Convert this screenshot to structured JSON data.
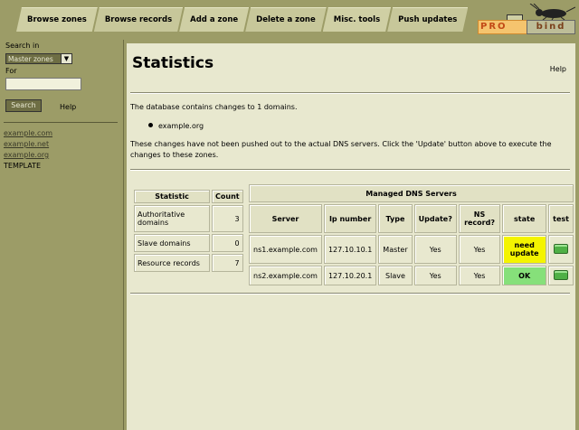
{
  "nav": {
    "tabs": [
      "Browse zones",
      "Browse records",
      "Add a zone",
      "Delete a zone",
      "Misc. tools",
      "Push updates"
    ]
  },
  "logo": {
    "pro": "PRO",
    "bind": "bind"
  },
  "sidebar": {
    "search_in_label": "Search in",
    "zone_type_selected": "Master zones",
    "for_label": "For",
    "search_value": "",
    "search_button": "Search",
    "help_link": "Help",
    "domains": [
      "example.com",
      "example.net",
      "example.org"
    ],
    "template": "TEMPLATE"
  },
  "main": {
    "title": "Statistics",
    "help_link": "Help",
    "changes_text": "The database contains changes to 1 domains.",
    "changed_domain": "example.org",
    "not_pushed_text": "These changes have not been pushed out to the actual DNS servers. Click the 'Update' button above to execute the changes to these zones."
  },
  "stats_table": {
    "headers": [
      "Statistic",
      "Count"
    ],
    "rows": [
      {
        "label": "Authoritative domains",
        "count": "3"
      },
      {
        "label": "Slave domains",
        "count": "0"
      },
      {
        "label": "Resource records",
        "count": "7"
      }
    ]
  },
  "servers_table": {
    "caption": "Managed DNS Servers",
    "headers": [
      "Server",
      "Ip number",
      "Type",
      "Update?",
      "NS record?",
      "state",
      "test"
    ],
    "rows": [
      {
        "server": "ns1.example.com",
        "ip": "127.10.10.1",
        "type": "Master",
        "update": "Yes",
        "ns": "Yes",
        "state": "need update",
        "state_color": "#f4f400"
      },
      {
        "server": "ns2.example.com",
        "ip": "127.10.20.1",
        "type": "Slave",
        "update": "Yes",
        "ns": "Yes",
        "state": "OK",
        "state_color": "#86e07a"
      }
    ]
  }
}
